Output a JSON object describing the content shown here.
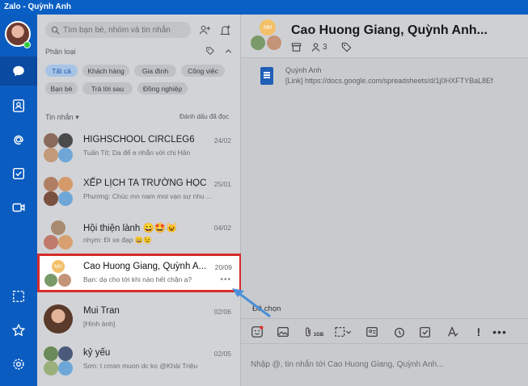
{
  "window": {
    "title": "Zalo - Quỳnh Anh"
  },
  "sidebar": {
    "icons": [
      "chat-icon",
      "contacts-icon",
      "mention-icon",
      "todo-icon",
      "video-icon",
      "screenshot-icon",
      "star-icon",
      "settings-icon"
    ]
  },
  "search": {
    "placeholder": "Tìm bạn bè, nhóm và tin nhắn"
  },
  "filter": {
    "label": "Phân loại",
    "chips": [
      "Tất cả",
      "Khách hàng",
      "Gia đình",
      "Công việc",
      "Bạn bè",
      "Trả lời sau",
      "Đồng nghiệp"
    ],
    "active": "Tất cả"
  },
  "list_header": {
    "messages_label": "Tin nhắn",
    "mark_read": "Đánh dấu đã đọc"
  },
  "conversations": [
    {
      "name": "HIGHSCHOOL CIRCLEG6",
      "time": "24/02",
      "preview": "Tuấn Tít: Da để e nhắn với chị Hân"
    },
    {
      "name": "XẾP LỊCH TA TRƯỜNG HỌC",
      "time": "25/01",
      "preview": "Phương: Chúc mn nam moi vạn sự nhu ..."
    },
    {
      "name": "Hội thiện lành 😄🤩😺",
      "time": "04/02",
      "preview": "nhym: Đi xe đạp 😄😉"
    },
    {
      "name": "Cao Huong Giang, Quỳnh A...",
      "time": "20/09",
      "preview": "Bạn: dạ cho tới khi nào hết chặn ạ?",
      "more": "•••",
      "avatar_initials": "NH"
    },
    {
      "name": "Mui Tran",
      "time": "02/06",
      "preview": "[Hình ảnh]"
    },
    {
      "name": "kỷ yếu",
      "time": "02/05",
      "preview": "Sơn: t cmsn muon dc ko @Khải Triệu"
    }
  ],
  "chat": {
    "title": "Cao Huong Giang, Quỳnh Anh...",
    "header_initials": "NH",
    "member_count": "3",
    "message": {
      "sender": "Quỳnh Anh",
      "text": "[Link] https://docs.google.com/spreadsheets/d/1j0HXFTYBaL8Ef"
    },
    "selected_label": "Đã chọn",
    "composer_placeholder": "Nhập @, tin nhắn tới Cao Huong Giang, Quỳnh Anh...",
    "attach_size": "1GB"
  },
  "colors": {
    "rail": "#0b5cc0",
    "titlebar": "#0a5fc4",
    "highlight_border": "#d62b2b",
    "arrow": "#4a90d9"
  }
}
